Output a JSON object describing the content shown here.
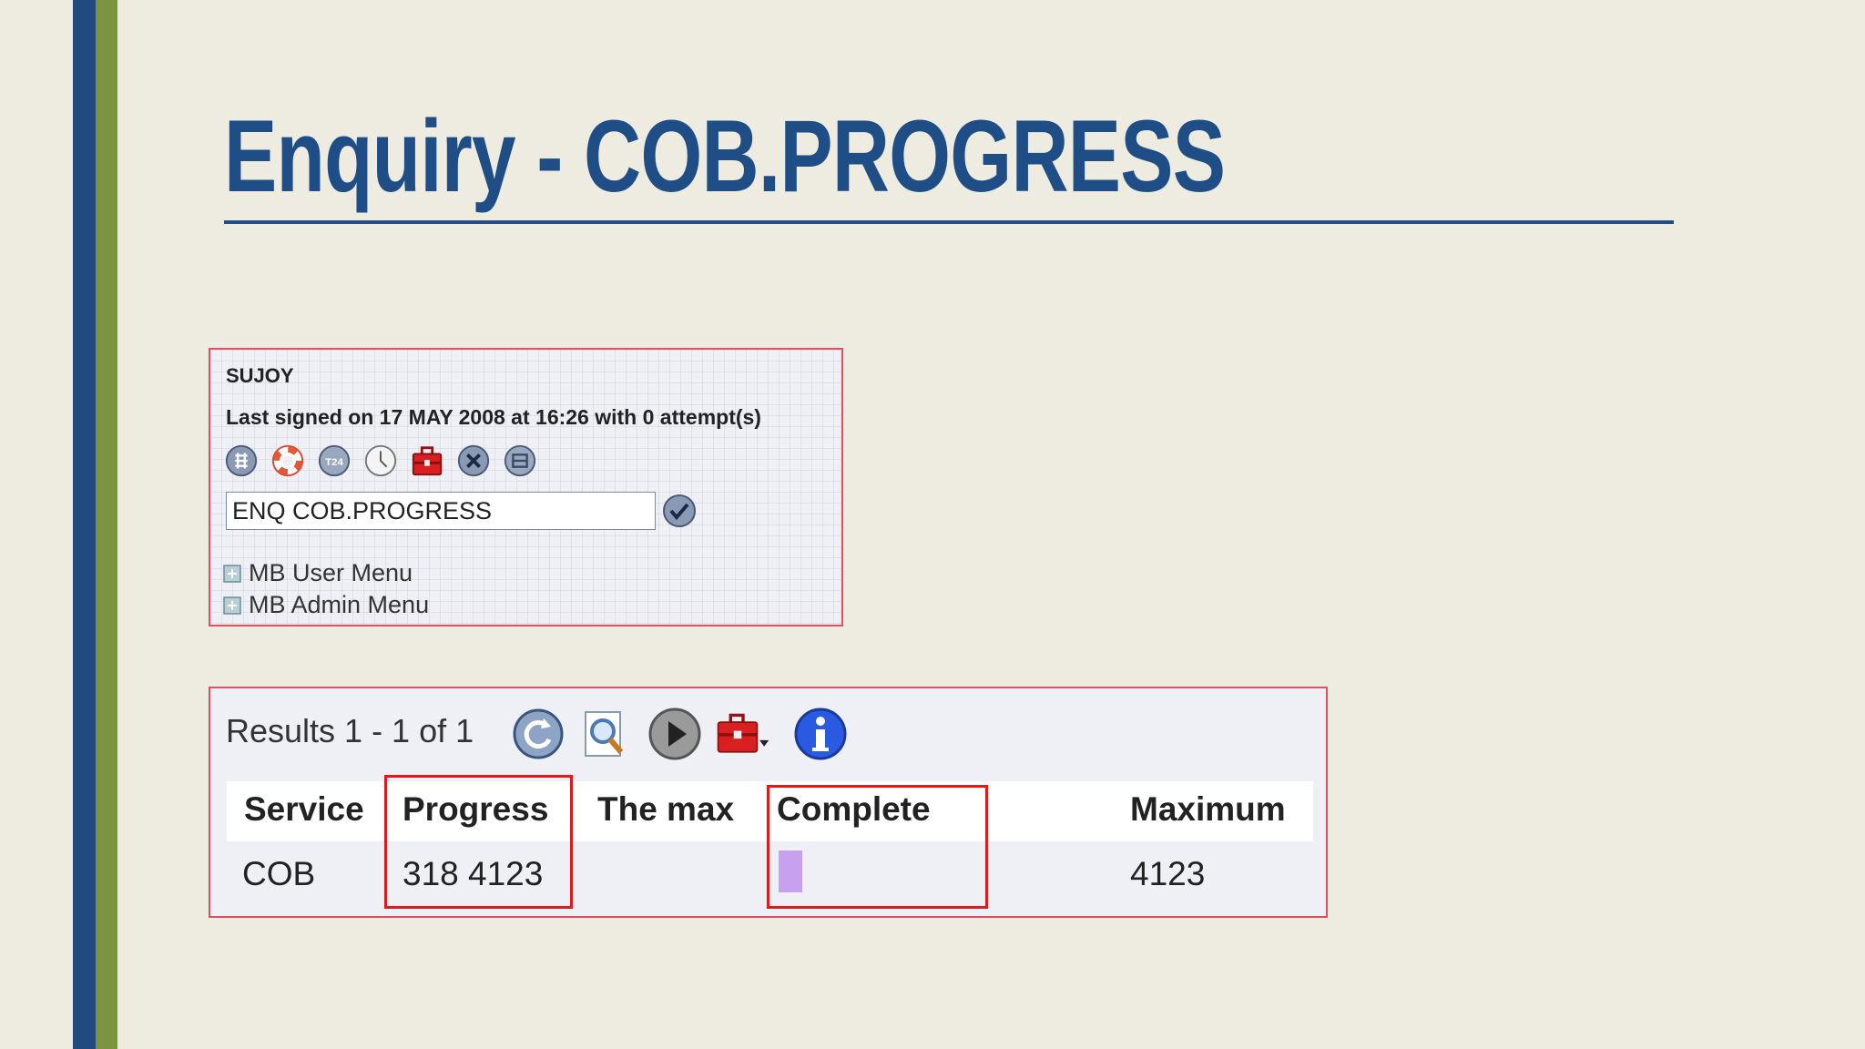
{
  "slide": {
    "title": "Enquiry - COB.PROGRESS",
    "colors": {
      "title": "#1f4e86",
      "stripe_blue": "#234a7e",
      "stripe_green": "#7a943f",
      "highlight": "#e01a1a"
    }
  },
  "login_panel": {
    "user": "SUJOY",
    "last_signed": "Last signed on 17 MAY 2008 at 16:26 with 0 attempt(s)",
    "toolbar_icons": [
      "home-icon",
      "help-lifebuoy-icon",
      "t24-icon",
      "clock-icon",
      "toolbox-icon",
      "close-icon",
      "minimize-icon"
    ],
    "command_value": "ENQ COB.PROGRESS",
    "menus": [
      "MB User Menu",
      "MB Admin Menu"
    ]
  },
  "results_panel": {
    "results_label": "Results 1 - 1 of 1",
    "icons": [
      "refresh-icon",
      "magnify-icon",
      "play-icon",
      "toolbox-dropdown-icon",
      "info-icon"
    ],
    "columns": [
      "Service",
      "Progress",
      "The max",
      "Complete",
      "Maximum"
    ],
    "rows": [
      {
        "service": "COB",
        "progress": "318 4123",
        "the_max": "",
        "complete_color": "#c8a0f0",
        "maximum": "4123"
      }
    ]
  }
}
